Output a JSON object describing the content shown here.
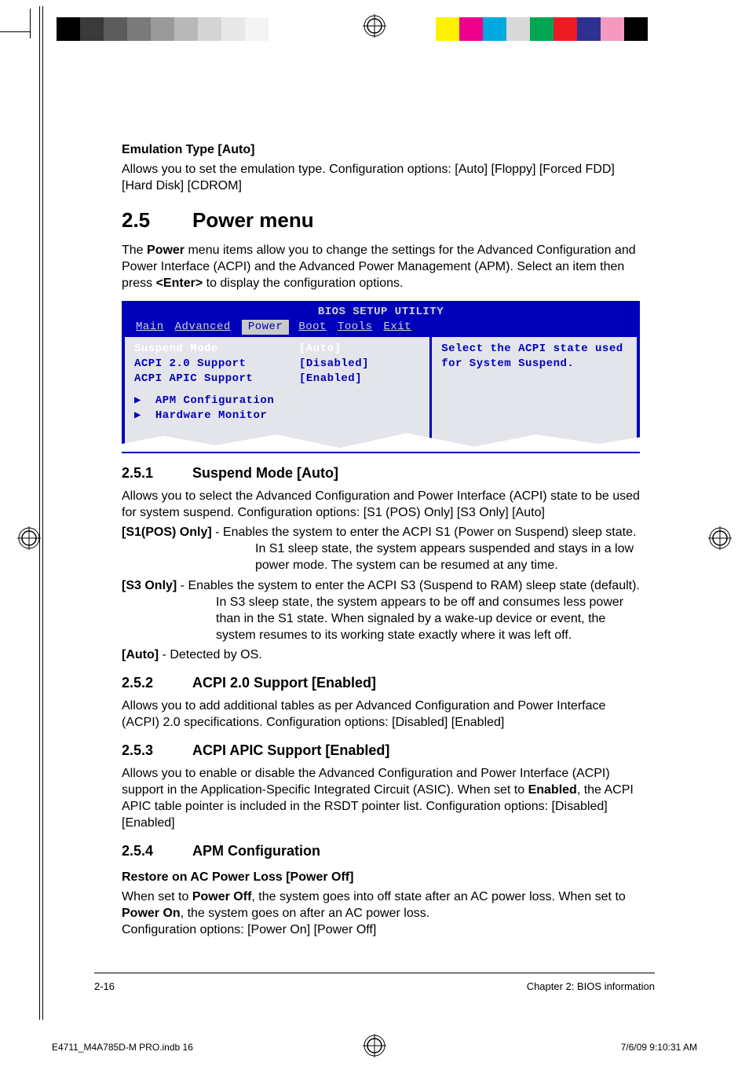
{
  "colorbars": {
    "left": [
      "#000000",
      "#3a3a3a",
      "#5c5c5c",
      "#7a7a7a",
      "#9a9a9a",
      "#b8b8b8",
      "#d4d4d4",
      "#e8e8e8",
      "#f4f4f4",
      "#ffffff"
    ],
    "right": [
      "#ffffff",
      "#fff200",
      "#ec008c",
      "#00a9e0",
      "#d8d8d8",
      "#00a651",
      "#ed1c24",
      "#2e3192",
      "#f599c1",
      "#000000"
    ]
  },
  "emu": {
    "heading": "Emulation Type [Auto]",
    "body": "Allows you to set the emulation type. Configuration options: [Auto] [Floppy] [Forced FDD] [Hard Disk] [CDROM]"
  },
  "sec25": {
    "num": "2.5",
    "title": "Power menu",
    "intro_a": "The ",
    "intro_b": "Power",
    "intro_c": " menu items allow you to change the settings for the Advanced Configuration and Power Interface (ACPI) and the Advanced Power Management (APM). Select an item then press ",
    "intro_d": "<Enter>",
    "intro_e": " to display the configuration options."
  },
  "bios": {
    "title": "BIOS SETUP UTILITY",
    "menu": [
      "Main",
      "Advanced",
      "Power",
      "Boot",
      "Tools",
      "Exit"
    ],
    "selected_menu": "Power",
    "rows": [
      {
        "k": "Suspend Mode",
        "v": "[Auto]",
        "sel": true
      },
      {
        "k": "ACPI 2.0 Support",
        "v": "[Disabled]"
      },
      {
        "k": "ACPI APIC Support",
        "v": "[Enabled]"
      }
    ],
    "submenus": [
      "APM Configuration",
      "Hardware Monitor"
    ],
    "help": "Select the ACPI state used for System Suspend."
  },
  "s251": {
    "num": "2.5.1",
    "title": "Suspend Mode [Auto]",
    "intro": "Allows you to select the Advanced Configuration and Power Interface (ACPI) state to be used for system suspend. Configuration options: [S1 (POS) Only] [S3 Only] [Auto]",
    "o1_label": "[S1(POS) Only]",
    "o1_text": " - Enables the system to enter the ACPI S1 (Power on Suspend) sleep state. In S1 sleep state, the system appears suspended and stays in a low power mode. The system can be resumed at any time.",
    "o2_label": "[S3 Only]",
    "o2_text": " - Enables the system to enter the ACPI S3 (Suspend to RAM) sleep state (default). In S3 sleep state, the system appears to be off and consumes less power than in the S1 state. When signaled by a wake-up device or event, the system resumes to its working state exactly where it was left off.",
    "o3_label": "[Auto]",
    "o3_text": " - Detected by OS."
  },
  "s252": {
    "num": "2.5.2",
    "title": "ACPI 2.0 Support [Enabled]",
    "body": "Allows you to add additional tables as per Advanced Configuration and Power Interface (ACPI) 2.0 specifications. Configuration options: [Disabled] [Enabled]"
  },
  "s253": {
    "num": "2.5.3",
    "title": "ACPI APIC Support [Enabled]",
    "body_a": "Allows you to enable or disable the Advanced Configuration and Power Interface (ACPI) support in the Application-Specific Integrated Circuit (ASIC). When set to ",
    "body_b": "Enabled",
    "body_c": ", the ACPI APIC table pointer is included in the RSDT pointer list. Configuration options: [Disabled] [Enabled]"
  },
  "s254": {
    "num": "2.5.4",
    "title": "APM Configuration"
  },
  "restore": {
    "heading": "Restore on AC Power Loss [Power Off]",
    "a": "When set to ",
    "b": "Power Off",
    "c": ", the system goes into off state after an AC power loss. When set to ",
    "d": "Power On",
    "e": ", the system goes on after an AC power loss.",
    "f": "Configuration options: [Power On] [Power Off]"
  },
  "footer": {
    "left": "2-16",
    "right": "Chapter 2: BIOS information"
  },
  "printfoot": {
    "left": "E4711_M4A785D-M PRO.indb   16",
    "right": "7/6/09   9:10:31 AM"
  }
}
